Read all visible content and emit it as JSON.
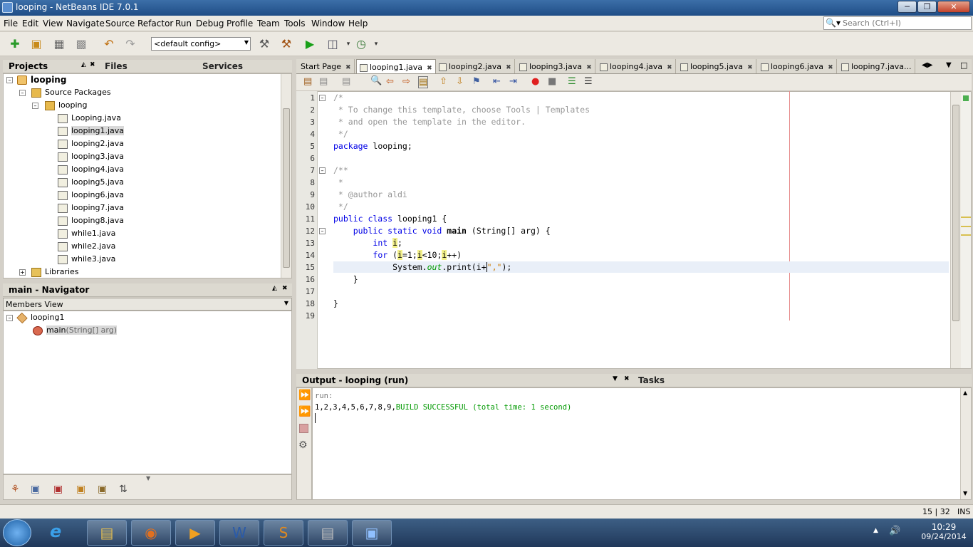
{
  "window": {
    "title": "looping - NetBeans IDE 7.0.1"
  },
  "menu": {
    "items": [
      "File",
      "Edit",
      "View",
      "Navigate",
      "Source",
      "Refactor",
      "Run",
      "Debug",
      "Profile",
      "Team",
      "Tools",
      "Window",
      "Help"
    ]
  },
  "search": {
    "placeholder": "Search (Ctrl+I)"
  },
  "toolbar": {
    "config": "<default config>"
  },
  "projects_panel": {
    "tabs": [
      "Projects",
      "Files",
      "Services"
    ],
    "tree": {
      "project": "looping",
      "source_packages": "Source Packages",
      "package": "looping",
      "files": [
        "Looping.java",
        "looping1.java",
        "looping2.java",
        "looping3.java",
        "looping4.java",
        "looping5.java",
        "looping6.java",
        "looping7.java",
        "looping8.java",
        "while1.java",
        "while2.java",
        "while3.java"
      ],
      "selected_file": "looping1.java",
      "libraries": "Libraries"
    }
  },
  "navigator": {
    "title": "main - Navigator",
    "view": "Members View",
    "class": "looping1",
    "method": "main",
    "method_params": "(String[] arg)"
  },
  "editor": {
    "tabs": [
      "Start Page",
      "looping1.java",
      "looping2.java",
      "looping3.java",
      "looping4.java",
      "looping5.java",
      "looping6.java",
      "looping7.java..."
    ],
    "active_tab": "looping1.java",
    "line_numbers": [
      "1",
      "2",
      "3",
      "4",
      "5",
      "6",
      "7",
      "8",
      "9",
      "10",
      "11",
      "12",
      "13",
      "14",
      "15",
      "16",
      "17",
      "18",
      "19"
    ],
    "code": {
      "l1": "/*",
      "l2": " * To change this template, choose Tools | Templates",
      "l3": " * and open the template in the editor.",
      "l4": " */",
      "l5_kw": "package",
      "l5_rest": " looping;",
      "l7": "/**",
      "l8": " *",
      "l9": " * @author aldi",
      "l10": " */",
      "l11_kw": "public class",
      "l11_rest": " looping1 {",
      "l12_kw": "public static void",
      "l12_name": "main",
      "l12_rest": " (String[] arg) {",
      "l13_kw": "int",
      "l13_var": "i",
      "l13_end": ";",
      "l14_kw": "for",
      "l14_p1": " (",
      "l14_v1": "i",
      "l14_p2": "=1;",
      "l14_v2": "i",
      "l14_p3": "<10;",
      "l14_v3": "i",
      "l14_p4": "++)",
      "l15_a": "System.",
      "l15_out": "out",
      "l15_b": ".print(i+",
      "l15_str": "\",\"",
      "l15_c": ");",
      "l16": "}",
      "l18": "}"
    }
  },
  "output": {
    "title": "Output - looping (run)",
    "tasks_tab": "Tasks",
    "run_line": "run:",
    "result_numbers": "1,2,3,4,5,6,7,8,9,",
    "result_build": "BUILD SUCCESSFUL (total time: 1 second)"
  },
  "status": {
    "position": "15 | 32",
    "mode": "INS"
  },
  "taskbar": {
    "time": "10:29",
    "date": "09/24/2014"
  },
  "colors": {
    "keyword": "#0000e6",
    "comment": "#969696",
    "string": "#ce7b00",
    "static_field": "#009900",
    "build_success": "#009900",
    "titlebar": "#2b5a94"
  }
}
